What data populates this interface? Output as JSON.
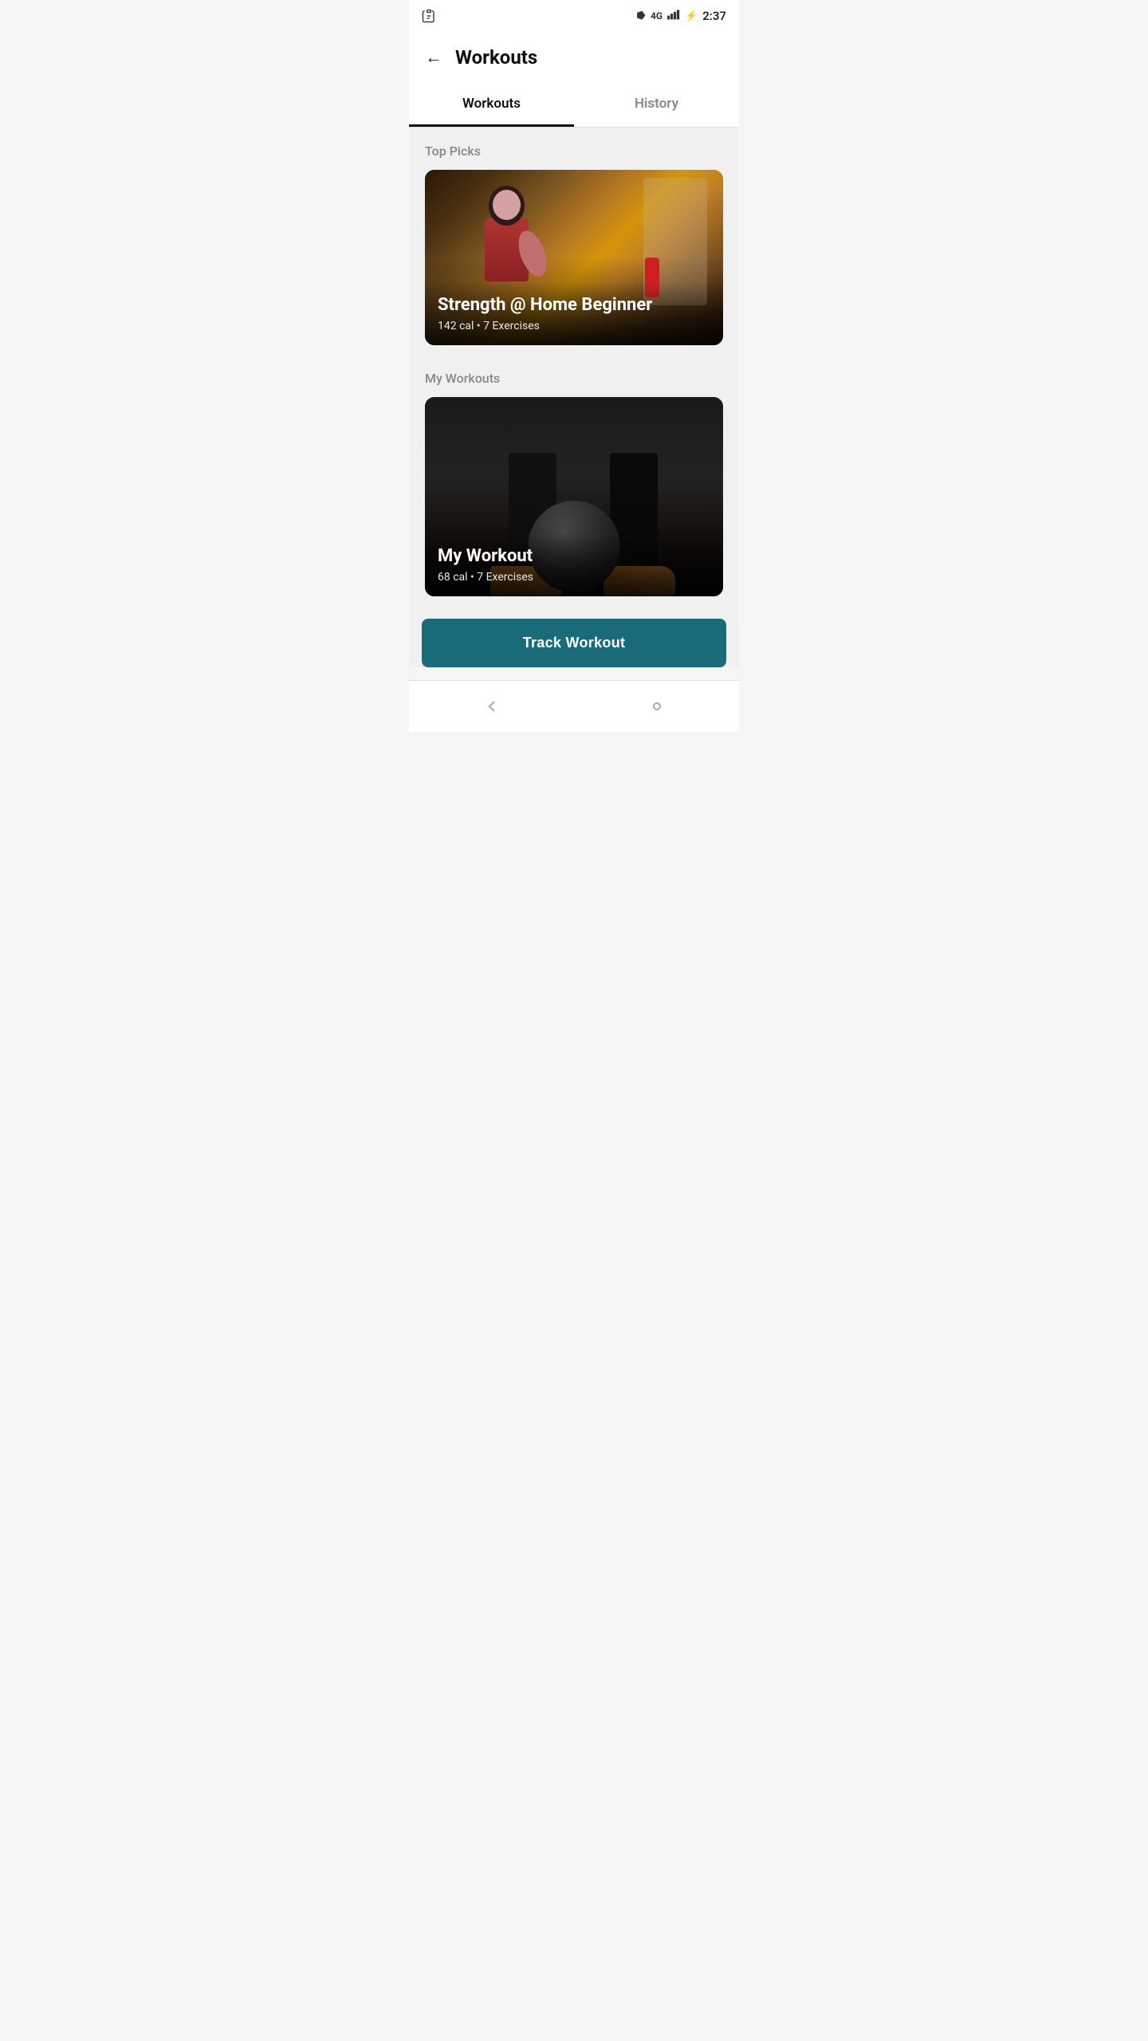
{
  "statusBar": {
    "time": "2:37",
    "bluetooth": "BT",
    "network": "4G",
    "battery": "⚡"
  },
  "header": {
    "back_label": "←",
    "title": "Workouts"
  },
  "tabs": [
    {
      "id": "workouts",
      "label": "Workouts",
      "active": true
    },
    {
      "id": "history",
      "label": "History",
      "active": false
    }
  ],
  "topPicks": {
    "section_title": "Top Picks",
    "card": {
      "title": "Strength @ Home Beginner",
      "meta": "142 cal • 7 Exercises"
    }
  },
  "myWorkouts": {
    "section_title": "My Workouts",
    "card": {
      "title": "My Workout",
      "meta": "68 cal • 7 Exercises"
    }
  },
  "trackButton": {
    "label": "Track Workout"
  },
  "bottomNav": {
    "icons": [
      "back-arrow",
      "home-icon"
    ]
  }
}
